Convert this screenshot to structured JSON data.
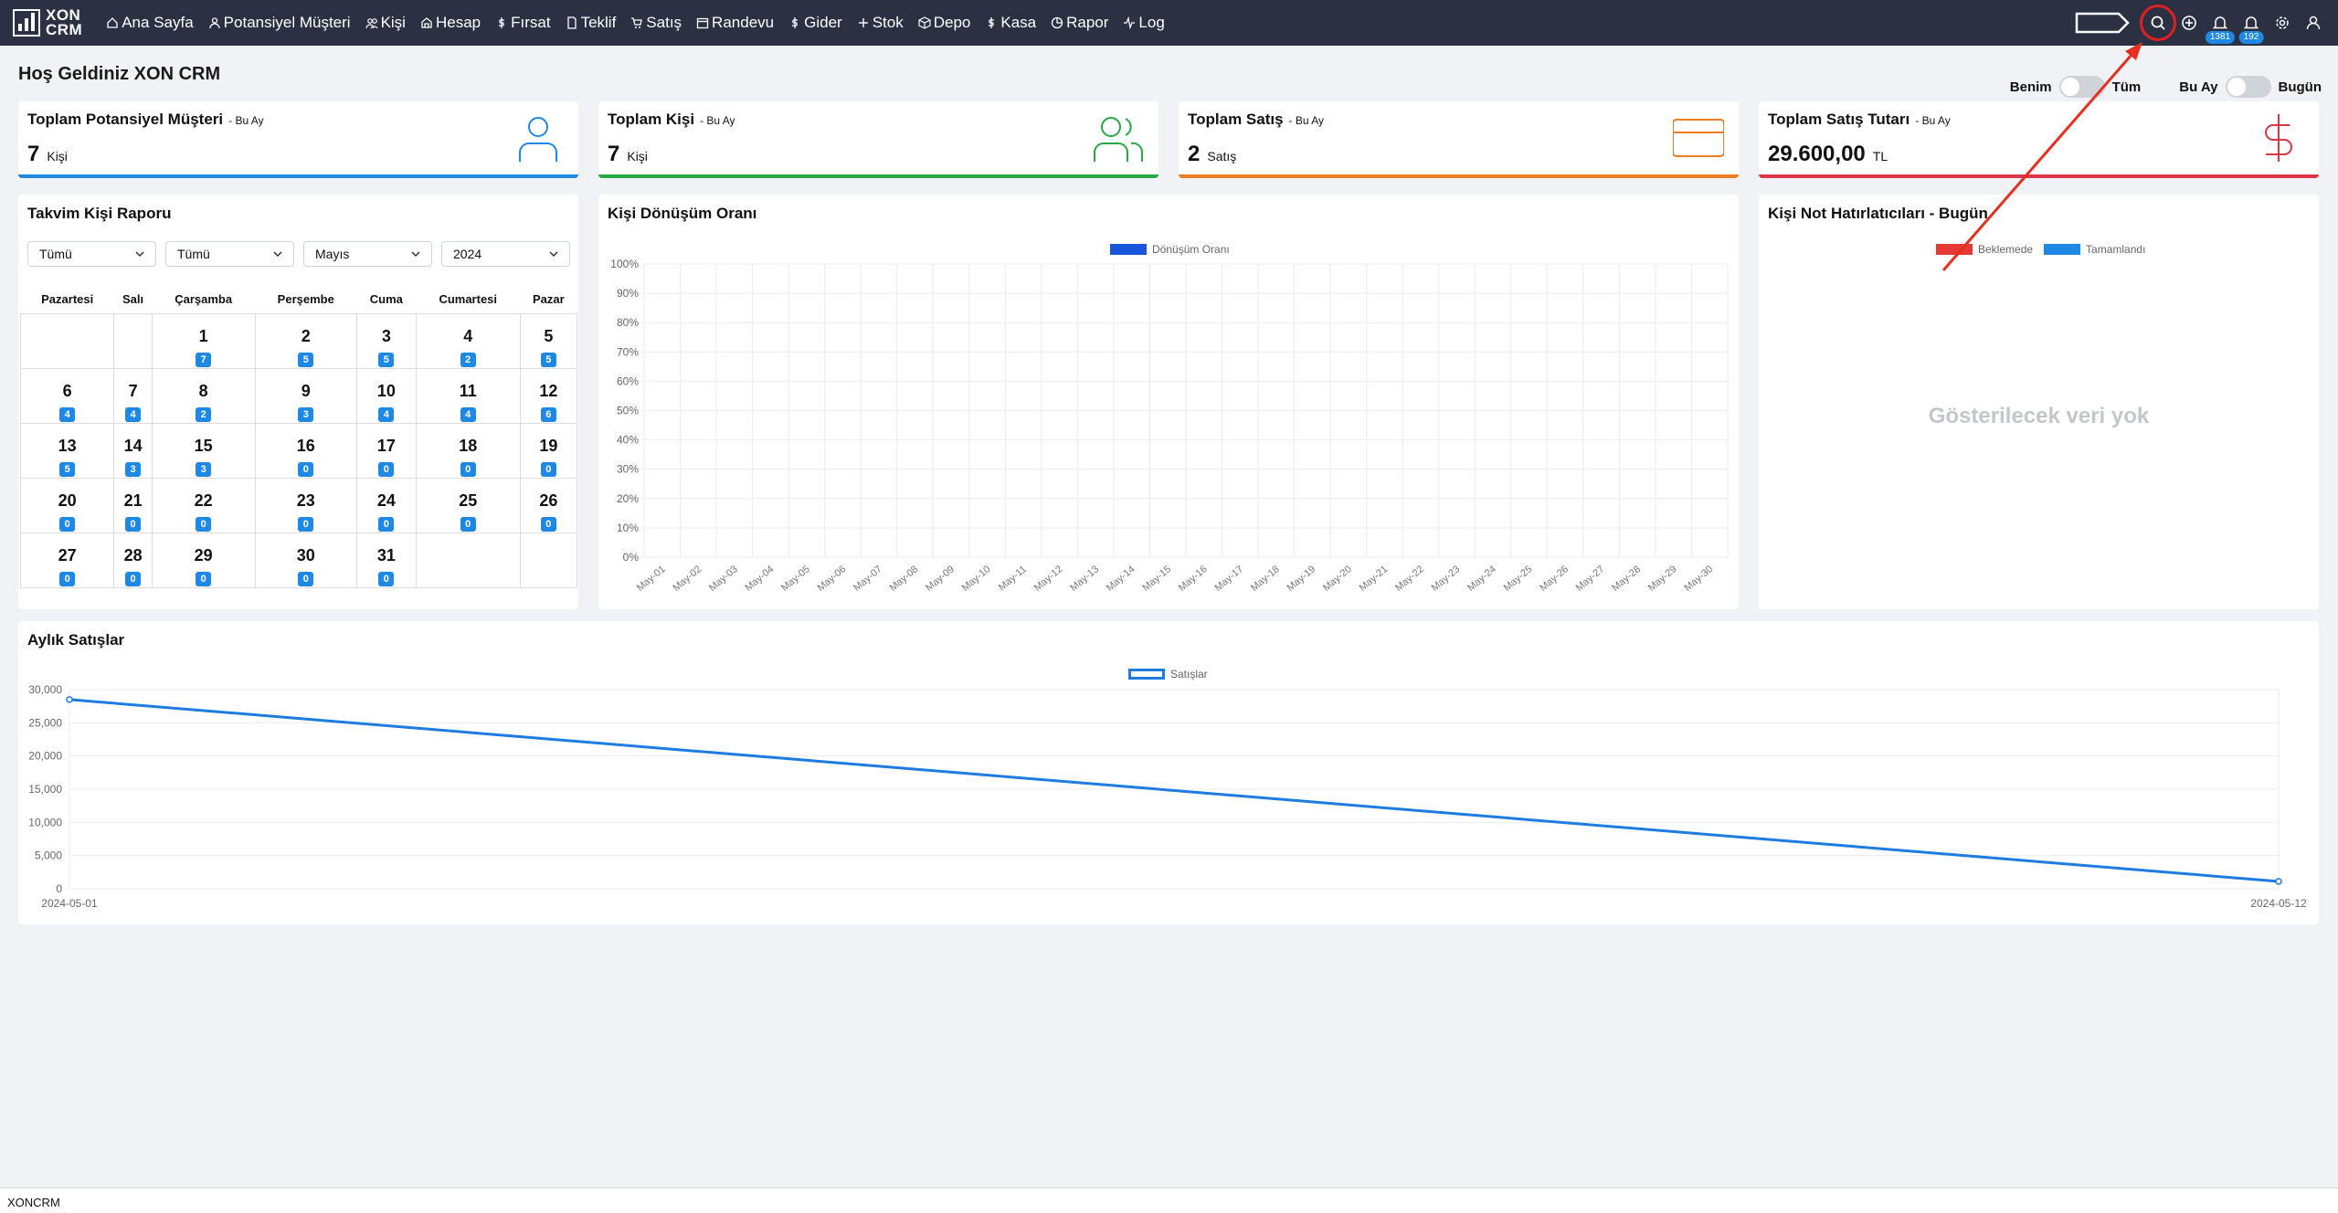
{
  "app": {
    "logo_text_line1": "XON",
    "logo_text_line2": "CRM"
  },
  "nav": [
    {
      "label": "Ana Sayfa",
      "icon": "home-icon"
    },
    {
      "label": "Potansiyel Müşteri",
      "icon": "person-icon"
    },
    {
      "label": "Kişi",
      "icon": "people-icon"
    },
    {
      "label": "Hesap",
      "icon": "building-icon"
    },
    {
      "label": "Fırsat",
      "icon": "dollar-icon"
    },
    {
      "label": "Teklif",
      "icon": "document-icon"
    },
    {
      "label": "Satış",
      "icon": "cart-icon"
    },
    {
      "label": "Randevu",
      "icon": "calendar-icon"
    },
    {
      "label": "Gider",
      "icon": "dollar-icon"
    },
    {
      "label": "Stok",
      "icon": "plus-icon"
    },
    {
      "label": "Depo",
      "icon": "box-icon"
    },
    {
      "label": "Kasa",
      "icon": "dollar-icon"
    },
    {
      "label": "Rapor",
      "icon": "chart-icon"
    },
    {
      "label": "Log",
      "icon": "activity-icon"
    }
  ],
  "nav_badges": {
    "notifications": "1381",
    "alerts": "192"
  },
  "header": {
    "welcome": "Hoş Geldiniz XON CRM"
  },
  "toggles": {
    "left_on": "Benim",
    "left_off": "Tüm",
    "right_on": "Bu Ay",
    "right_off": "Bugün"
  },
  "stats": [
    {
      "title": "Toplam Potansiyel Müşteri",
      "period": "- Bu Ay",
      "value": "7",
      "unit": "Kişi",
      "color": "#1e88e5"
    },
    {
      "title": "Toplam Kişi",
      "period": "- Bu Ay",
      "value": "7",
      "unit": "Kişi",
      "color": "#28a745"
    },
    {
      "title": "Toplam Satış",
      "period": "- Bu Ay",
      "value": "2",
      "unit": "Satış",
      "color": "#f07c22"
    },
    {
      "title": "Toplam Satış Tutarı",
      "period": "- Bu Ay",
      "value": "29.600,00",
      "unit": "TL",
      "color": "#dc3545"
    }
  ],
  "calendar": {
    "title": "Takvim Kişi Raporu",
    "selects": [
      "Tümü",
      "Tümü",
      "Mayıs",
      "2024"
    ],
    "weekdays": [
      "Pazartesi",
      "Salı",
      "Çarşamba",
      "Perşembe",
      "Cuma",
      "Cumartesi",
      "Pazar"
    ],
    "weeks": [
      [
        null,
        null,
        {
          "d": "1",
          "c": "7"
        },
        {
          "d": "2",
          "c": "5"
        },
        {
          "d": "3",
          "c": "5"
        },
        {
          "d": "4",
          "c": "2"
        },
        {
          "d": "5",
          "c": "5"
        }
      ],
      [
        {
          "d": "6",
          "c": "4"
        },
        {
          "d": "7",
          "c": "4"
        },
        {
          "d": "8",
          "c": "2"
        },
        {
          "d": "9",
          "c": "3"
        },
        {
          "d": "10",
          "c": "4"
        },
        {
          "d": "11",
          "c": "4"
        },
        {
          "d": "12",
          "c": "6"
        }
      ],
      [
        {
          "d": "13",
          "c": "5"
        },
        {
          "d": "14",
          "c": "3"
        },
        {
          "d": "15",
          "c": "3"
        },
        {
          "d": "16",
          "c": "0"
        },
        {
          "d": "17",
          "c": "0"
        },
        {
          "d": "18",
          "c": "0"
        },
        {
          "d": "19",
          "c": "0"
        }
      ],
      [
        {
          "d": "20",
          "c": "0"
        },
        {
          "d": "21",
          "c": "0"
        },
        {
          "d": "22",
          "c": "0"
        },
        {
          "d": "23",
          "c": "0"
        },
        {
          "d": "24",
          "c": "0"
        },
        {
          "d": "25",
          "c": "0"
        },
        {
          "d": "26",
          "c": "0"
        }
      ],
      [
        {
          "d": "27",
          "c": "0"
        },
        {
          "d": "28",
          "c": "0"
        },
        {
          "d": "29",
          "c": "0"
        },
        {
          "d": "30",
          "c": "0"
        },
        {
          "d": "31",
          "c": "0"
        },
        null,
        null
      ]
    ]
  },
  "conversion": {
    "title": "Kişi Dönüşüm Oranı"
  },
  "reminders": {
    "title": "Kişi Not Hatırlatıcıları - Bugün",
    "legend": [
      {
        "name": "Beklemede",
        "color": "#e53935"
      },
      {
        "name": "Tamamlandı",
        "color": "#1e88e5"
      }
    ],
    "no_data": "Gösterilecek veri yok"
  },
  "monthly": {
    "title": "Aylık Satışlar"
  },
  "footer": {
    "text": "XONCRM"
  },
  "chart_data": [
    {
      "type": "bar",
      "legend": [
        "Dönüşüm Oranı"
      ],
      "series_color": "#1a56db",
      "categories": [
        "May-01",
        "May-02",
        "May-03",
        "May-04",
        "May-05",
        "May-06",
        "May-07",
        "May-08",
        "May-09",
        "May-10",
        "May-11",
        "May-12",
        "May-13",
        "May-14",
        "May-15",
        "May-16",
        "May-17",
        "May-18",
        "May-19",
        "May-20",
        "May-21",
        "May-22",
        "May-23",
        "May-24",
        "May-25",
        "May-26",
        "May-27",
        "May-28",
        "May-29",
        "May-30"
      ],
      "series": [
        {
          "name": "Dönüşüm Oranı",
          "values": [
            0,
            0,
            0,
            0,
            0,
            0,
            0,
            0,
            0,
            0,
            0,
            0,
            0,
            0,
            0,
            0,
            0,
            0,
            0,
            0,
            0,
            0,
            0,
            0,
            0,
            0,
            0,
            0,
            0,
            0
          ]
        }
      ],
      "yticks": [
        "0%",
        "10%",
        "20%",
        "30%",
        "40%",
        "50%",
        "60%",
        "70%",
        "80%",
        "90%",
        "100%"
      ],
      "ylim": [
        0,
        100
      ],
      "grid": true,
      "legend_position": "top"
    },
    {
      "type": "line",
      "legend": [
        "Satışlar"
      ],
      "series_color": "#1e7be0",
      "x": [
        "2024-05-01",
        "2024-05-12"
      ],
      "series": [
        {
          "name": "Satışlar",
          "values": [
            28500,
            1100
          ]
        }
      ],
      "yticks": [
        "0",
        "5,000",
        "10,000",
        "15,000",
        "20,000",
        "25,000",
        "30,000"
      ],
      "ylim": [
        0,
        30000
      ],
      "grid": true,
      "legend_position": "top"
    }
  ]
}
